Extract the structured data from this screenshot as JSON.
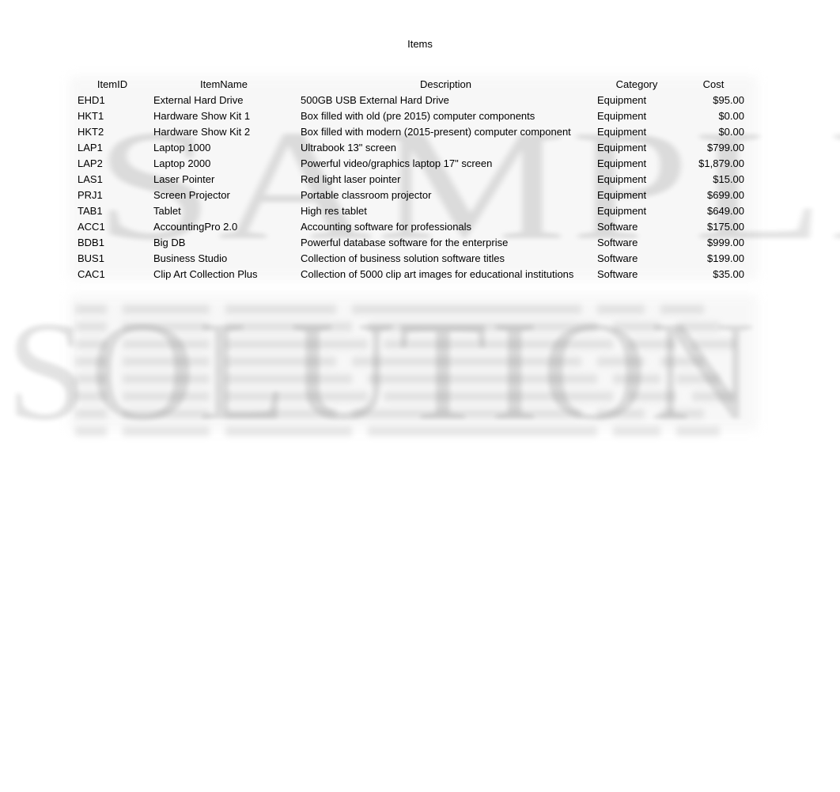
{
  "document": {
    "title": "Items",
    "watermark": {
      "line1": "SAMPLE",
      "line2": "SOLUTION"
    }
  },
  "table": {
    "headers": [
      "ItemID",
      "ItemName",
      "Description",
      "Category",
      "Cost"
    ],
    "rows": [
      {
        "id": "EHD1",
        "name": "External Hard Drive",
        "description": "500GB USB External Hard Drive",
        "category": "Equipment",
        "cost": "$95.00"
      },
      {
        "id": "HKT1",
        "name": "Hardware Show Kit 1",
        "description": "Box filled with old (pre 2015) computer components",
        "category": "Equipment",
        "cost": "$0.00"
      },
      {
        "id": "HKT2",
        "name": "Hardware Show Kit 2",
        "description": "Box filled with modern  (2015-present) computer component",
        "category": "Equipment",
        "cost": "$0.00"
      },
      {
        "id": "LAP1",
        "name": "Laptop 1000",
        "description": "Ultrabook 13\" screen",
        "category": "Equipment",
        "cost": "$799.00"
      },
      {
        "id": "LAP2",
        "name": "Laptop 2000",
        "description": "Powerful video/graphics laptop  17\" screen",
        "category": "Equipment",
        "cost": "$1,879.00"
      },
      {
        "id": "LAS1",
        "name": "Laser Pointer",
        "description": "Red light laser pointer",
        "category": "Equipment",
        "cost": "$15.00"
      },
      {
        "id": "PRJ1",
        "name": "Screen Projector",
        "description": "Portable classroom projector",
        "category": "Equipment",
        "cost": "$699.00"
      },
      {
        "id": "TAB1",
        "name": "Tablet",
        "description": "High res tablet",
        "category": "Equipment",
        "cost": "$649.00"
      },
      {
        "id": "ACC1",
        "name": "AccountingPro 2.0",
        "description": "Accounting software for professionals",
        "category": "Software",
        "cost": "$175.00"
      },
      {
        "id": "BDB1",
        "name": "Big DB",
        "description": "Powerful database software for the enterprise",
        "category": "Software",
        "cost": "$999.00"
      },
      {
        "id": "BUS1",
        "name": "Business Studio",
        "description": "Collection of business solution software titles",
        "category": "Software",
        "cost": "$199.00"
      },
      {
        "id": "CAC1",
        "name": "Clip Art Collection Plus",
        "description": "Collection of 5000 clip art images for educational institutions",
        "category": "Software",
        "cost": "$35.00"
      }
    ]
  }
}
